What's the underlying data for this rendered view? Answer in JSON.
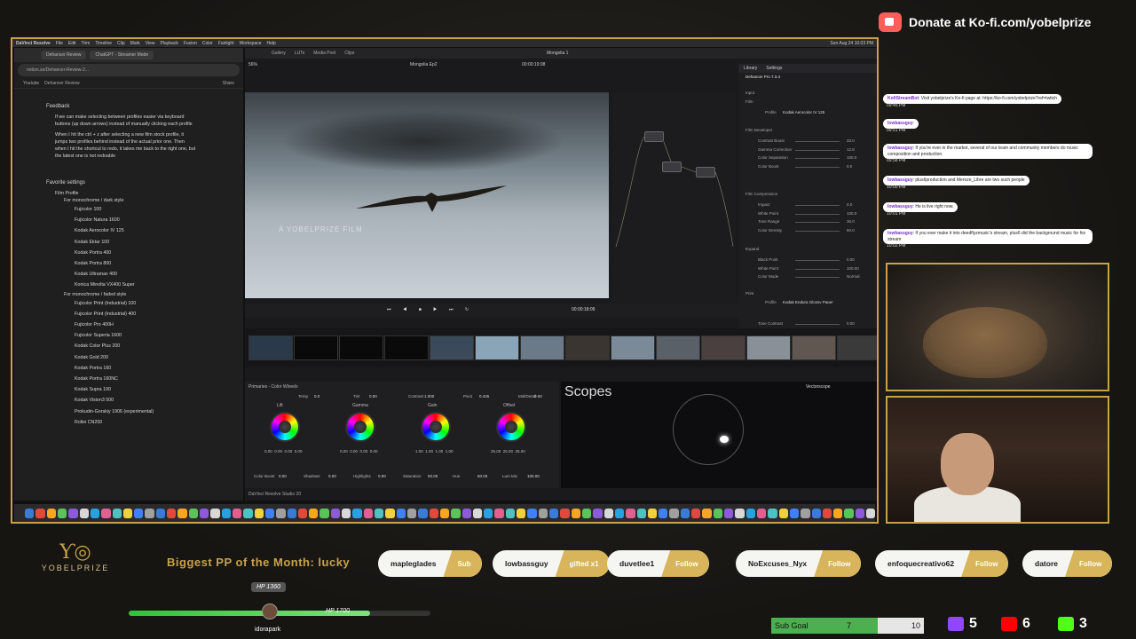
{
  "donate": {
    "text": "Donate at Ko-fi.com/yobelprize"
  },
  "menubar": [
    "DaVinci Resolve",
    "File",
    "Edit",
    "Trim",
    "Timeline",
    "Clip",
    "Mark",
    "View",
    "Playback",
    "Fusion",
    "Color",
    "Fairlight",
    "Workspace",
    "Help",
    "Sun Aug 24 10:03 PM"
  ],
  "browser": {
    "tabs": [
      "Dehancer Review",
      "ChatGPT - Streamer Mode"
    ],
    "url": "notion.so/Dehancer-Review-2...",
    "crumbs": [
      "Youtube",
      "Dehancer Review",
      "Share"
    ],
    "feedback_title": "Feedback",
    "feedback": [
      "If we can make selecting between profiles easier via keyboard buttons (up down arrows) instead of manually clicking each profile",
      "When I hit the ctrl + z after selecting a new film stock profile, it jumps two profiles behind instead of the actual prior one. Then when I hit the shortcut to redo, it takes me back to the right one, but the latest one is not redoable"
    ],
    "fav_title": "Favorite settings",
    "film_profile": "Film Profile",
    "mono_dark": "For monochrome / dark style",
    "dark_list": [
      "Fujicolor 100",
      "Fujicolor Natura 1600",
      "Kodak Aerocolor IV 125",
      "Kodak Ektar 100",
      "Kodak Portra 400",
      "Kodak Portra 800",
      "Kodak Ultramax 400",
      "Konica Minolta VX400 Super"
    ],
    "mono_faded": "For monochrome / faded style",
    "faded_list": [
      "Fujicolor Print (Industrial) 100",
      "Fujicolor Print (Industrial) 400",
      "Fujicolor Pro 400H",
      "Fujicolor Superia 1600",
      "Kodak Color Plus 200",
      "Kodak Gold 200",
      "Kodak Portra 160",
      "Kodak Portra 160NC",
      "Kodak Supra 100",
      "Kodak Vision3 500",
      "Prokudin-Gorskiy 1906 (experimental)",
      "Rollei CN200"
    ]
  },
  "resolve": {
    "title": "Mongolia 1",
    "timeline_name": "Mongolia Ep2",
    "timecode_top": "00:00:19:08",
    "timecode": "00:00:18:09",
    "zoom": "56%",
    "watermark": "A YOBELPRIZE FILM",
    "inspector_title": "Dehancer Pro 7.3.4",
    "inspector_tabs": [
      "Library",
      "Settings"
    ],
    "profile_label": "Profile",
    "profile_value": "Kodak Aerocolor IV 125",
    "film_params": [
      [
        "Contrast Boost",
        "33.0"
      ],
      [
        "Gamma Correction",
        "12.8"
      ],
      [
        "Color Separation",
        "100.0"
      ],
      [
        "Color Boost",
        "0.0"
      ]
    ],
    "compression": [
      [
        "Impact",
        "0.0"
      ],
      [
        "White Point",
        "100.0"
      ],
      [
        "Tone Range",
        "30.0"
      ],
      [
        "Color Density",
        "50.0"
      ]
    ],
    "expand": [
      [
        "Black Point",
        "0.00"
      ],
      [
        "White Point",
        "100.00"
      ],
      [
        "Color Mode",
        "Normal"
      ]
    ],
    "print_profile": "Kodak Endura Glossy Paper",
    "print_params": [
      [
        "Exposure",
        "0.00"
      ],
      [
        "Tone Contrast",
        "0.00"
      ],
      [
        "Color Density",
        "0.00"
      ]
    ],
    "panel_title": "Primaries - Color Wheels",
    "scopes_title": "Scopes",
    "vectorscope_label": "Vectorscope",
    "wheels": [
      {
        "label": "Lift",
        "values": "0.00  0.00  0.00  0.00"
      },
      {
        "label": "Gamma",
        "values": "0.00  0.00  0.00  0.00"
      },
      {
        "label": "Gain",
        "values": "1.00  1.00  1.00  1.00"
      },
      {
        "label": "Offset",
        "values": "25.00  25.00  25.00"
      }
    ],
    "params_top": [
      [
        "Temp",
        "0.0"
      ],
      [
        "Tint",
        "0.00"
      ],
      [
        "Contrast",
        "1.000"
      ],
      [
        "Pivot",
        "0.435"
      ],
      [
        "Mid/Detail",
        "0.00"
      ]
    ],
    "params_bottom": [
      [
        "Color Boost",
        "0.00"
      ],
      [
        "Shadows",
        "0.00"
      ],
      [
        "Highlights",
        "0.00"
      ],
      [
        "Saturation",
        "50.00"
      ],
      [
        "Hue",
        "50.00"
      ],
      [
        "Lum Mix",
        "100.00"
      ]
    ],
    "app_label": "DaVinci Resolve Studio 20"
  },
  "chat": [
    {
      "user": "KofiStreamBot",
      "text": "Visit yobelprize's Ko-fi page at: https://ko-fi.com/yobelprize?ref=twitch",
      "time": "09:45 PM"
    },
    {
      "user": "lowbassguy",
      "text": "",
      "time": "09:51 PM"
    },
    {
      "user": "lowbassguy",
      "text": "If you're ever in the market, several of our team and community members do music composition and production.",
      "time": "09:58 PM"
    },
    {
      "user": "lowbassguy",
      "text": "plus6production and Meroze_Libre are two such people",
      "time": "10:00 PM"
    },
    {
      "user": "lowbassguy",
      "text": "He is live right now.",
      "time": "10:01 PM"
    },
    {
      "user": "lowbassguy",
      "text": "If you ever make it into deedflyzmusic's stream, plus6 did the background music for his stream",
      "time": "10:02 PM"
    }
  ],
  "logo": {
    "name": "YOBELPRIZE"
  },
  "ticker": "Biggest PP of the Month: lucky",
  "alerts": [
    {
      "name": "mapleglades",
      "action": "Sub"
    },
    {
      "name": "lowbassguy",
      "action": "gifted x1"
    },
    {
      "name": "duvetlee1",
      "action": "Follow"
    },
    {
      "name": "NoExcuses_Nyx",
      "action": "Follow"
    },
    {
      "name": "enfoquecreativo62",
      "action": "Follow"
    },
    {
      "name": "datore",
      "action": "Follow"
    }
  ],
  "hp": {
    "current": "HP 1360",
    "max": "HP 1700",
    "user": "idorapark",
    "fraction": 0.8
  },
  "subgoal": {
    "label": "Sub Goal",
    "current": "7",
    "target": "10"
  },
  "stats": [
    {
      "icon": "twitch-icon",
      "value": "5",
      "color": "#9146ff"
    },
    {
      "icon": "youtube-icon",
      "value": "6",
      "color": "#ff0000"
    },
    {
      "icon": "kick-icon",
      "value": "3",
      "color": "#53fc18"
    }
  ],
  "colors": {
    "accent": "#c8a24a",
    "hp": "#33c23a",
    "kofi": "#ff5e5b"
  }
}
